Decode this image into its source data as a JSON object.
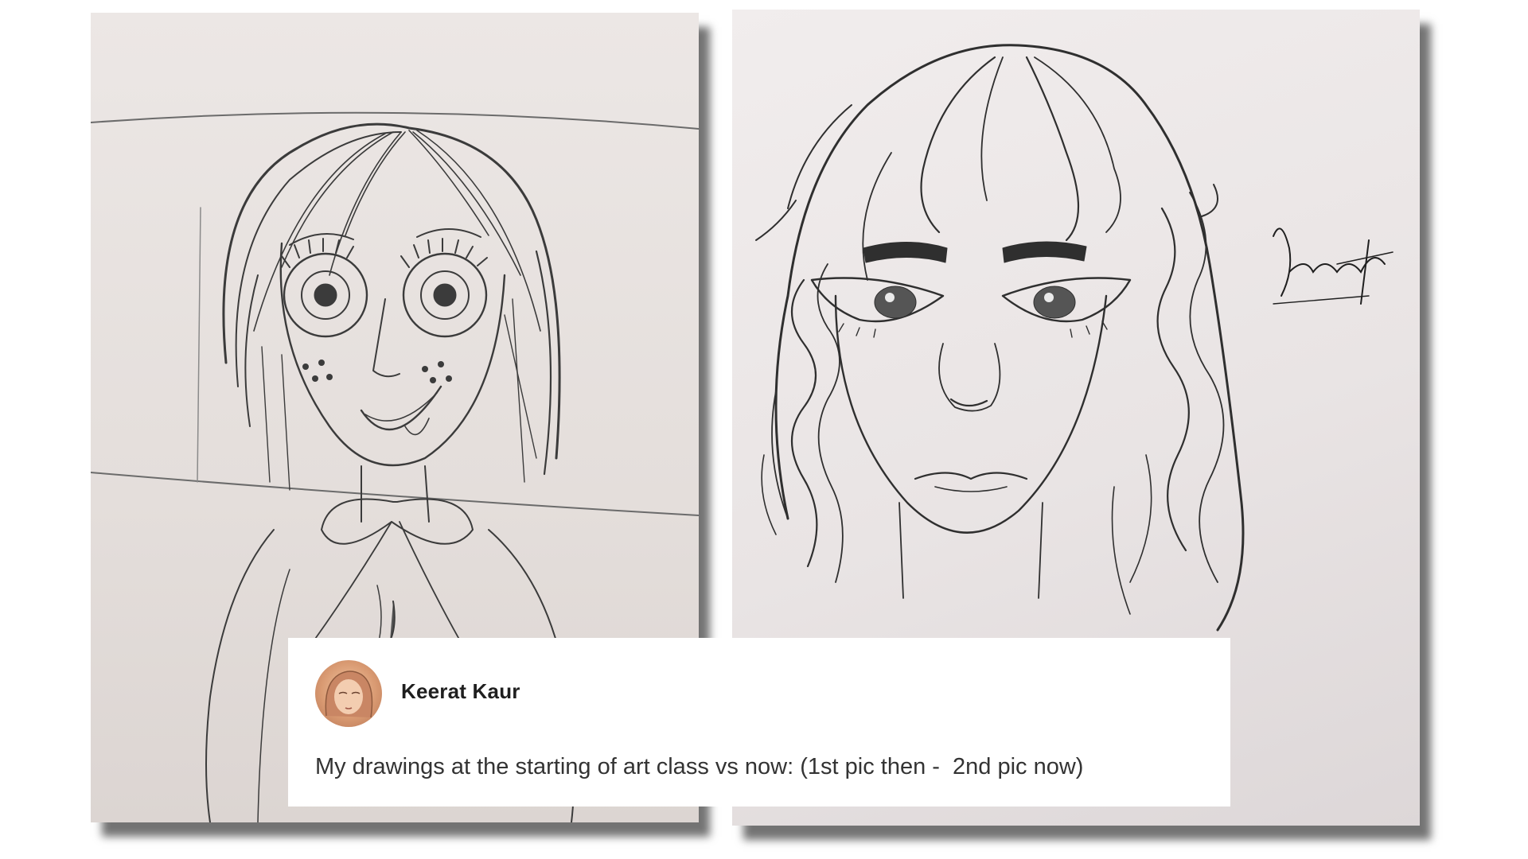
{
  "post": {
    "author": "Keerat Kaur",
    "caption": "My drawings at the starting of art class vs now: (1st pic then -  2nd pic now)",
    "signature": "Keerat"
  },
  "images": [
    {
      "description_id": "first-drawing",
      "style": "pencil-sketch"
    },
    {
      "description_id": "second-drawing",
      "style": "pencil-sketch"
    }
  ]
}
